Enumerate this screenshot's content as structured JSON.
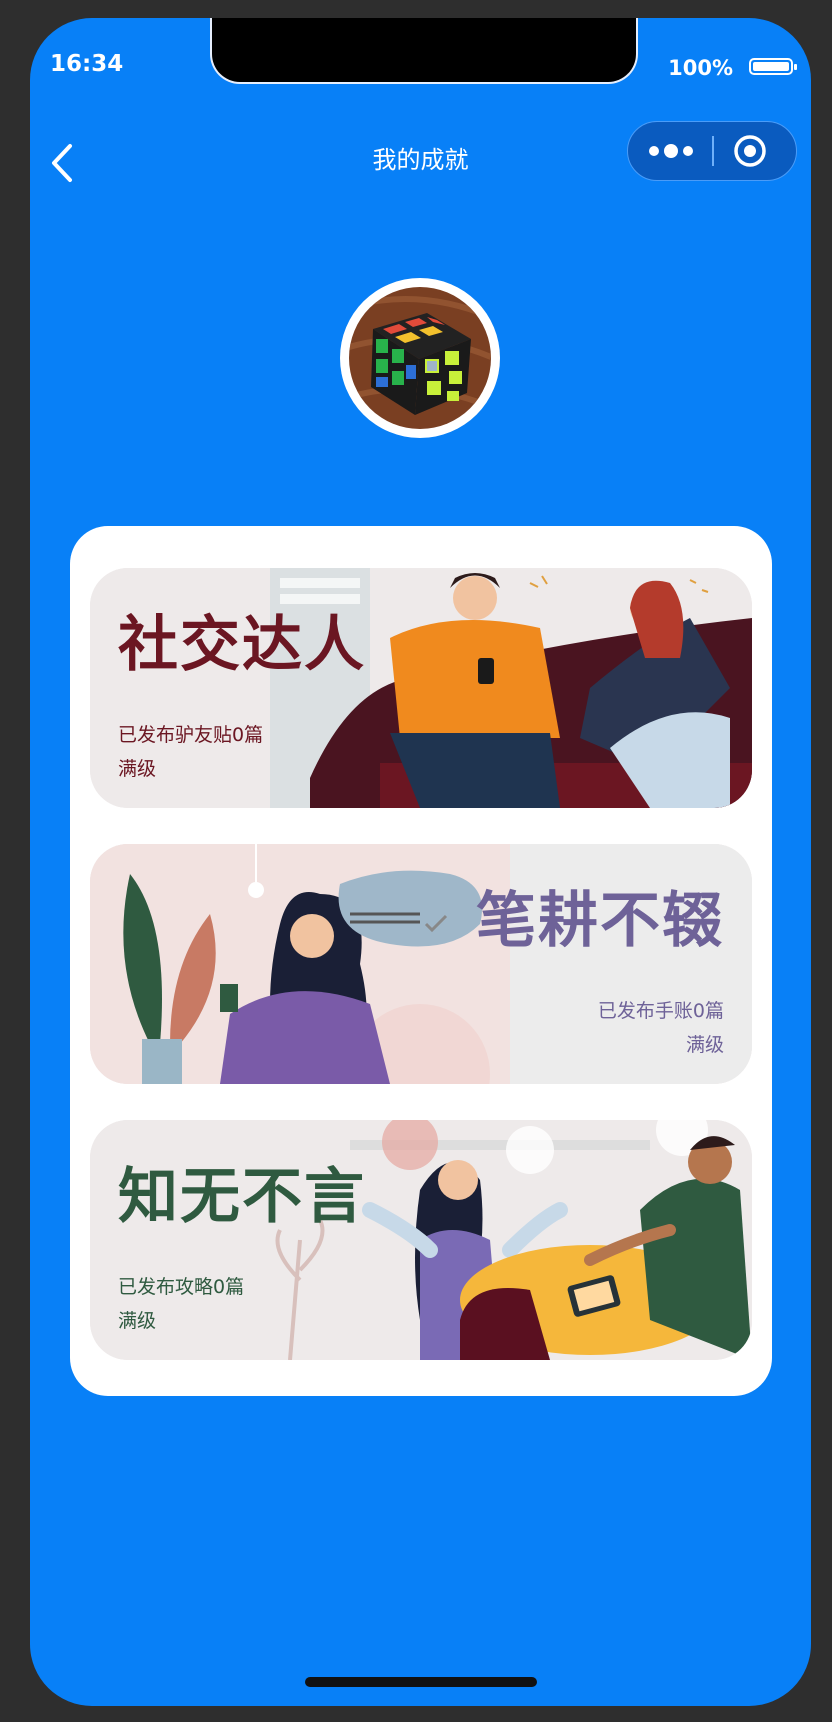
{
  "status_bar": {
    "time": "16:34",
    "battery": "100%"
  },
  "nav": {
    "title": "我的成就"
  },
  "achievements": [
    {
      "title": "社交达人",
      "count_text": "已发布驴友贴0篇",
      "level": "满级",
      "color": "#6b1622"
    },
    {
      "title": "笔耕不辍",
      "count_text": "已发布手账0篇",
      "level": "满级",
      "color": "#6e6298"
    },
    {
      "title": "知无不言",
      "count_text": "已发布攻略0篇",
      "level": "满级",
      "color": "#2f5a40"
    }
  ],
  "icons": [
    "back-icon",
    "more-icon",
    "close-icon",
    "battery-icon"
  ]
}
